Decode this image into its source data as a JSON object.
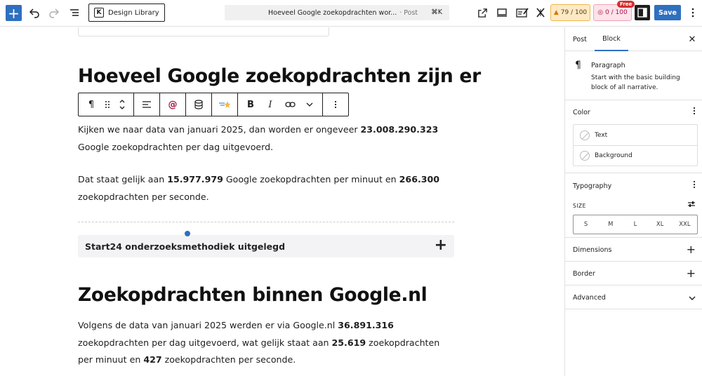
{
  "topbar": {
    "design_library": "Design Library",
    "design_library_icon": "K",
    "command_title": "Hoeveel Google zoekopdrachten wor...",
    "command_type": "· Post",
    "command_shortcut": "⌘K",
    "score_seo": "79 / 100",
    "score_read": "0 / 100",
    "free_badge": "Free",
    "save_label": "Save"
  },
  "content": {
    "heading1": "Hoeveel Google zoekopdrachten zijn er",
    "p1_a": "Kijken we naar data van januari 2025, dan worden er ongeveer ",
    "p1_b": "23.008.290.323",
    "p1_c": " Google zoekopdrachten per dag uitgevoerd.",
    "p2_a": "Dat staat gelijk aan ",
    "p2_b": "15.977.979",
    "p2_c": " Google zoekopdrachten per minuut en ",
    "p2_d": "266.300",
    "p2_e": " zoekopdrachten per seconde.",
    "accordion_title": "Start24 onderzoeksmethodiek uitgelegd",
    "heading2": "Zoekopdrachten binnen Google.nl",
    "p3_a": "Volgens de data van januari 2025 werden er via Google.nl ",
    "p3_b": "36.891.316",
    "p3_c": " zoekopdrachten per dag uitgevoerd, wat gelijk staat aan ",
    "p3_d": "25.619",
    "p3_e": " zoekopdrachten per minuut en ",
    "p3_f": "427",
    "p3_g": " zoekopdrachten per seconde."
  },
  "block_toolbar": {
    "paragraph_icon": "¶",
    "bold": "B",
    "italic": "I"
  },
  "sidebar": {
    "tab_post": "Post",
    "tab_block": "Block",
    "block_name": "Paragraph",
    "block_desc": "Start with the basic building block of all narrative.",
    "color_title": "Color",
    "color_text": "Text",
    "color_background": "Background",
    "typography_title": "Typography",
    "size_label": "SIZE",
    "sizes": [
      "S",
      "M",
      "L",
      "XL",
      "XXL"
    ],
    "dimensions_title": "Dimensions",
    "border_title": "Border",
    "advanced_title": "Advanced"
  },
  "colors": {
    "accent": "#2f6fbf",
    "text": "#1e1e1e"
  }
}
